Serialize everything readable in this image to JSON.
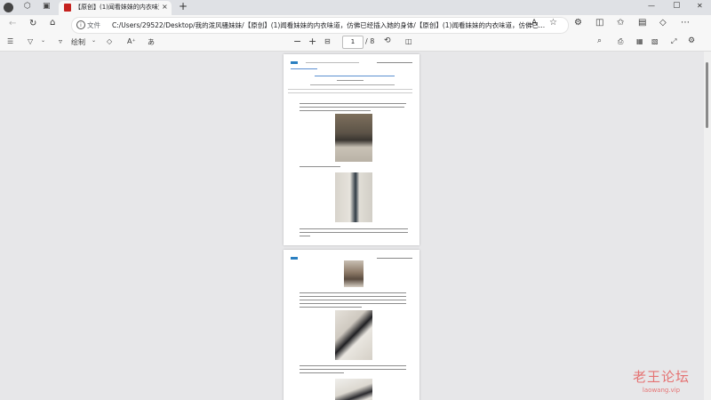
{
  "browser": {
    "active_tab": {
      "title": "【原创】(1)闻看妹妹的内衣味道, 仿",
      "close_glyph": "×"
    },
    "new_tab_glyph": "+",
    "window_controls": {
      "minimize": "—",
      "maximize": "▢",
      "close": "✕"
    },
    "address": {
      "label": "文件",
      "url": "C:/Users/29522/Desktop/我的泼风骚妹妹/【原创】(1)闻看妹妹的内衣味道，仿佛已经插入她的身体/【原创】(1)闻看妹妹的内衣味道，仿佛已..."
    }
  },
  "pdf_toolbar": {
    "draw_label": "绘制",
    "current_page": "1",
    "total_pages": "/ 8"
  },
  "watermark": {
    "main": "老王论坛",
    "sub": "laowang.vip"
  }
}
